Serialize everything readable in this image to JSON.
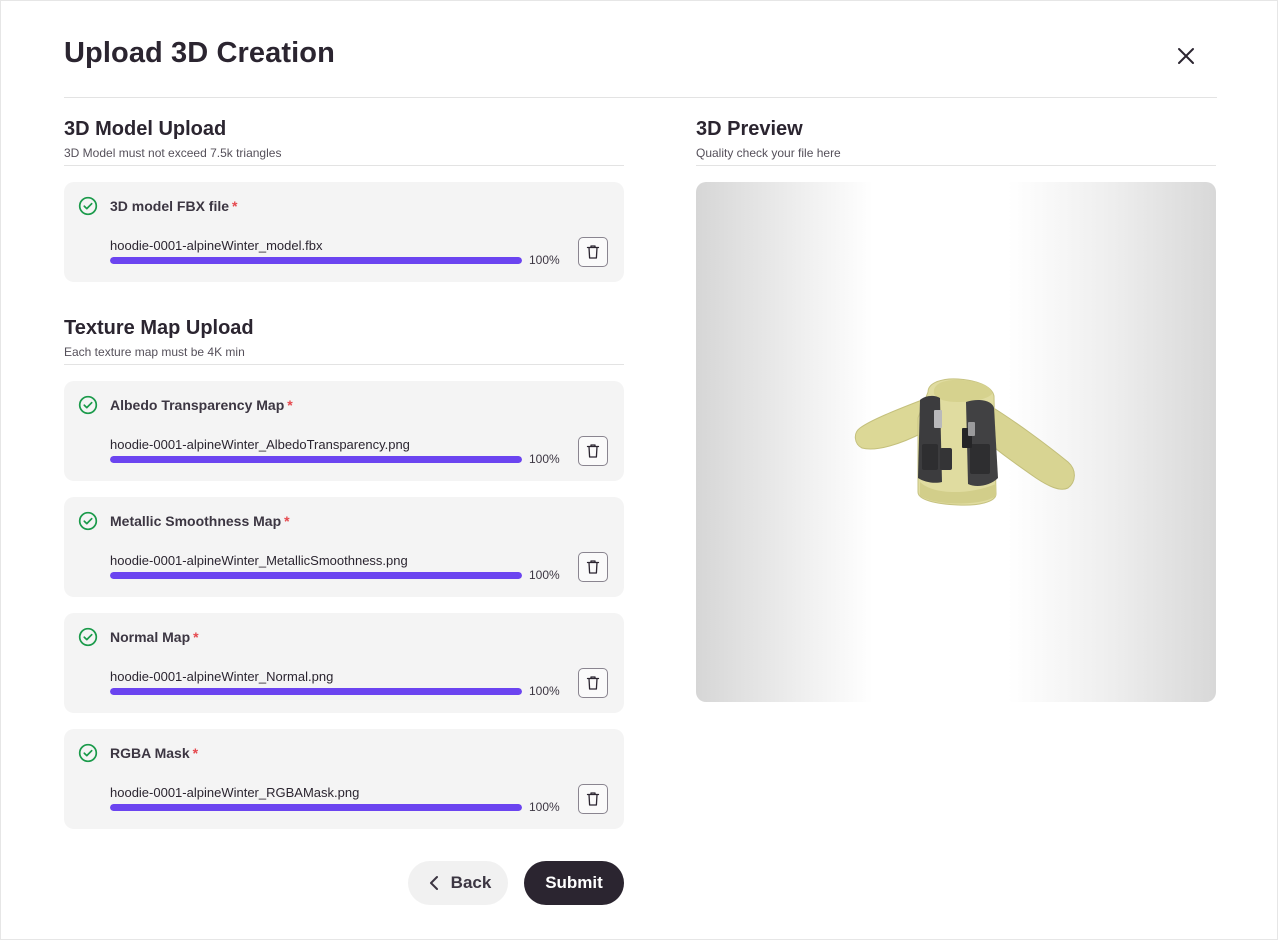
{
  "dialog": {
    "title": "Upload 3D Creation",
    "close_icon": "close-icon"
  },
  "model_section": {
    "title": "3D Model Upload",
    "subtitle": "3D Model must not exceed 7.5k triangles",
    "files": [
      {
        "label": "3D model FBX file",
        "required_mark": "*",
        "filename": "hoodie-0001-alpineWinter_model.fbx",
        "progress": 1.0,
        "progress_label": "100%",
        "status_icon": "check-circle-icon",
        "delete_icon": "trash-icon"
      }
    ]
  },
  "texture_section": {
    "title": "Texture Map Upload",
    "subtitle": "Each texture map must be 4K min",
    "files": [
      {
        "label": "Albedo Transparency Map",
        "required_mark": "*",
        "filename": "hoodie-0001-alpineWinter_AlbedoTransparency.png",
        "progress": 1.0,
        "progress_label": "100%",
        "status_icon": "check-circle-icon",
        "delete_icon": "trash-icon"
      },
      {
        "label": "Metallic Smoothness Map",
        "required_mark": "*",
        "filename": "hoodie-0001-alpineWinter_MetallicSmoothness.png",
        "progress": 1.0,
        "progress_label": "100%",
        "status_icon": "check-circle-icon",
        "delete_icon": "trash-icon"
      },
      {
        "label": "Normal Map",
        "required_mark": "*",
        "filename": "hoodie-0001-alpineWinter_Normal.png",
        "progress": 1.0,
        "progress_label": "100%",
        "status_icon": "check-circle-icon",
        "delete_icon": "trash-icon"
      },
      {
        "label": "RGBA Mask",
        "required_mark": "*",
        "filename": "hoodie-0001-alpineWinter_RGBAMask.png",
        "progress": 1.0,
        "progress_label": "100%",
        "status_icon": "check-circle-icon",
        "delete_icon": "trash-icon"
      }
    ]
  },
  "preview_section": {
    "title": "3D Preview",
    "subtitle": "Quality check your file here"
  },
  "footer": {
    "back_label": "Back",
    "back_icon": "chevron-left-icon",
    "submit_label": "Submit"
  },
  "colors": {
    "accent": "#6b44f0",
    "success": "#1a9a4a",
    "required": "#e5484d",
    "primary_button": "#2b2530"
  }
}
